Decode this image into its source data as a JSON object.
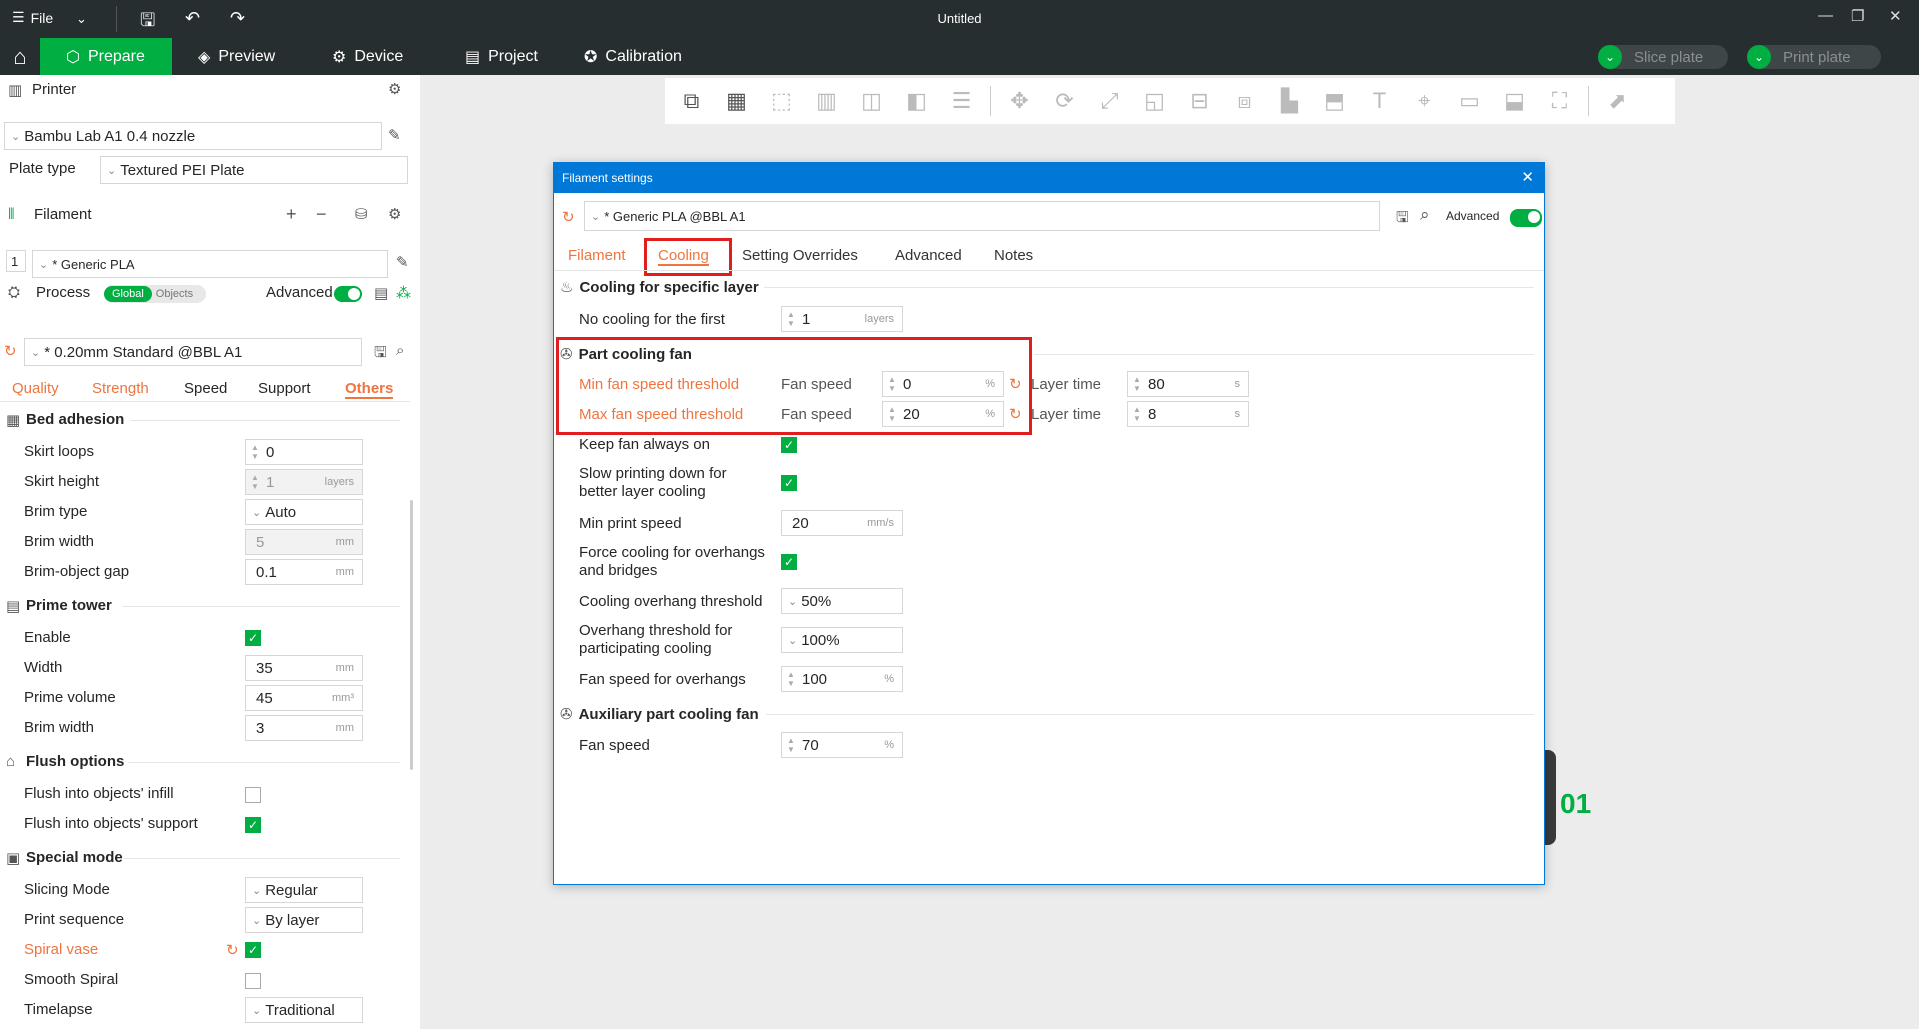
{
  "titlebar": {
    "file_label": "File",
    "title": "Untitled"
  },
  "nav": {
    "tabs": [
      {
        "label": "Prepare"
      },
      {
        "label": "Preview"
      },
      {
        "label": "Device"
      },
      {
        "label": "Project"
      },
      {
        "label": "Calibration"
      }
    ],
    "slice_label": "Slice plate",
    "print_label": "Print plate"
  },
  "left": {
    "printer_title": "Printer",
    "printer_value": "Bambu Lab A1 0.4 nozzle",
    "plate_type_label": "Plate type",
    "plate_type_value": "Textured PEI Plate",
    "filament_title": "Filament",
    "filament_index": "1",
    "filament_value": "* Generic PLA",
    "process_title": "Process",
    "process_global": "Global",
    "process_objects": "Objects",
    "advanced_label": "Advanced",
    "process_value": "* 0.20mm Standard @BBL A1",
    "subtabs": [
      "Quality",
      "Strength",
      "Speed",
      "Support",
      "Others"
    ],
    "bed_adhesion": {
      "title": "Bed adhesion",
      "skirt_loops_label": "Skirt loops",
      "skirt_loops_value": "0",
      "skirt_height_label": "Skirt height",
      "skirt_height_value": "1",
      "skirt_height_unit": "layers",
      "brim_type_label": "Brim type",
      "brim_type_value": "Auto",
      "brim_width_label": "Brim width",
      "brim_width_value": "5",
      "brim_width_unit": "mm",
      "brim_gap_label": "Brim-object gap",
      "brim_gap_value": "0.1",
      "brim_gap_unit": "mm"
    },
    "prime_tower": {
      "title": "Prime tower",
      "enable_label": "Enable",
      "width_label": "Width",
      "width_value": "35",
      "width_unit": "mm",
      "volume_label": "Prime volume",
      "volume_value": "45",
      "volume_unit": "mm³",
      "brim_label": "Brim width",
      "brim_value": "3",
      "brim_unit": "mm"
    },
    "flush": {
      "title": "Flush options",
      "infill_label": "Flush into objects' infill",
      "support_label": "Flush into objects' support"
    },
    "special": {
      "title": "Special mode",
      "slicing_label": "Slicing Mode",
      "slicing_value": "Regular",
      "sequence_label": "Print sequence",
      "sequence_value": "By layer",
      "spiral_label": "Spiral vase",
      "smooth_label": "Smooth Spiral",
      "timelapse_label": "Timelapse",
      "timelapse_value": "Traditional"
    }
  },
  "dialog": {
    "title": "Filament settings",
    "preset": "* Generic PLA @BBL A1",
    "advanced_label": "Advanced",
    "tabs": [
      "Filament",
      "Cooling",
      "Setting Overrides",
      "Advanced",
      "Notes"
    ],
    "cooling_layer": {
      "title": "Cooling for specific layer",
      "no_cooling_label": "No cooling for the first",
      "no_cooling_value": "1",
      "no_cooling_unit": "layers"
    },
    "part_fan": {
      "title": "Part cooling fan",
      "min_label": "Min fan speed threshold",
      "fan_speed_label": "Fan speed",
      "min_fan_value": "0",
      "pct": "%",
      "layer_time_label": "Layer time",
      "min_layer_time": "80",
      "sec": "s",
      "max_label": "Max fan speed threshold",
      "max_fan_value": "20",
      "max_layer_time": "8",
      "keep_on_label": "Keep fan always on",
      "slow_down_label_1": "Slow printing down for",
      "slow_down_label_2": "better layer cooling",
      "min_speed_label": "Min print speed",
      "min_speed_value": "20",
      "min_speed_unit": "mm/s",
      "force_label_1": "Force cooling for overhangs",
      "force_label_2": "and bridges",
      "overhang_threshold_label": "Cooling overhang threshold",
      "overhang_threshold_value": "50%",
      "participating_label_1": "Overhang threshold for",
      "participating_label_2": "participating cooling",
      "participating_value": "100%",
      "overhang_fan_label": "Fan speed for overhangs",
      "overhang_fan_value": "100"
    },
    "aux_fan": {
      "title": "Auxiliary part cooling fan",
      "fan_speed_label": "Fan speed",
      "fan_speed_value": "70"
    }
  },
  "canvas": {
    "model_label": "01"
  }
}
